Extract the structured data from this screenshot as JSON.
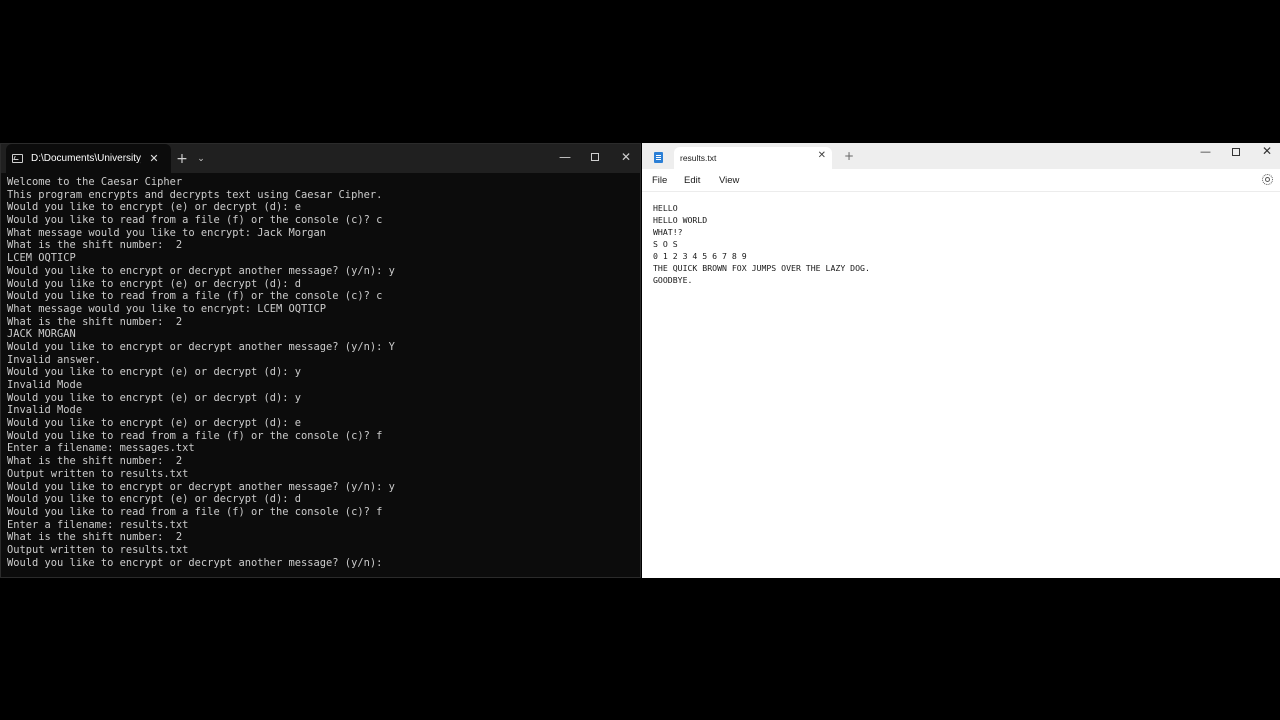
{
  "terminal": {
    "tab_title": "D:\\Documents\\University_Of_",
    "close_tab_glyph": "✕",
    "new_tab_glyph": "+",
    "dropdown_glyph": "⌄",
    "minimize_glyph": "—",
    "close_glyph": "✕",
    "lines": [
      "Welcome to the Caesar Cipher",
      "This program encrypts and decrypts text using Caesar Cipher.",
      "Would you like to encrypt (e) or decrypt (d): e",
      "Would you like to read from a file (f) or the console (c)? c",
      "What message would you like to encrypt: Jack Morgan",
      "What is the shift number:  2",
      "LCEM OQTICP",
      "Would you like to encrypt or decrypt another message? (y/n): y",
      "Would you like to encrypt (e) or decrypt (d): d",
      "Would you like to read from a file (f) or the console (c)? c",
      "What message would you like to encrypt: LCEM OQTICP",
      "What is the shift number:  2",
      "JACK MORGAN",
      "Would you like to encrypt or decrypt another message? (y/n): Y",
      "Invalid answer.",
      "Would you like to encrypt (e) or decrypt (d): y",
      "Invalid Mode",
      "Would you like to encrypt (e) or decrypt (d): y",
      "Invalid Mode",
      "Would you like to encrypt (e) or decrypt (d): e",
      "Would you like to read from a file (f) or the console (c)? f",
      "Enter a filename: messages.txt",
      "What is the shift number:  2",
      "Output written to results.txt",
      "Would you like to encrypt or decrypt another message? (y/n): y",
      "Would you like to encrypt (e) or decrypt (d): d",
      "Would you like to read from a file (f) or the console (c)? f",
      "Enter a filename: results.txt",
      "What is the shift number:  2",
      "Output written to results.txt",
      "Would you like to encrypt or decrypt another message? (y/n):"
    ]
  },
  "notepad": {
    "tab_title": "results.txt",
    "close_tab_glyph": "✕",
    "new_tab_glyph": "+",
    "minimize_glyph": "—",
    "close_glyph": "✕",
    "menu": [
      "File",
      "Edit",
      "View"
    ],
    "lines": [
      "HELLO",
      "HELLO WORLD",
      "WHAT!?",
      "S O S",
      "0 1 2 3 4 5 6 7 8 9",
      "THE QUICK BROWN FOX JUMPS OVER THE LAZY DOG.",
      "GOODBYE."
    ]
  }
}
